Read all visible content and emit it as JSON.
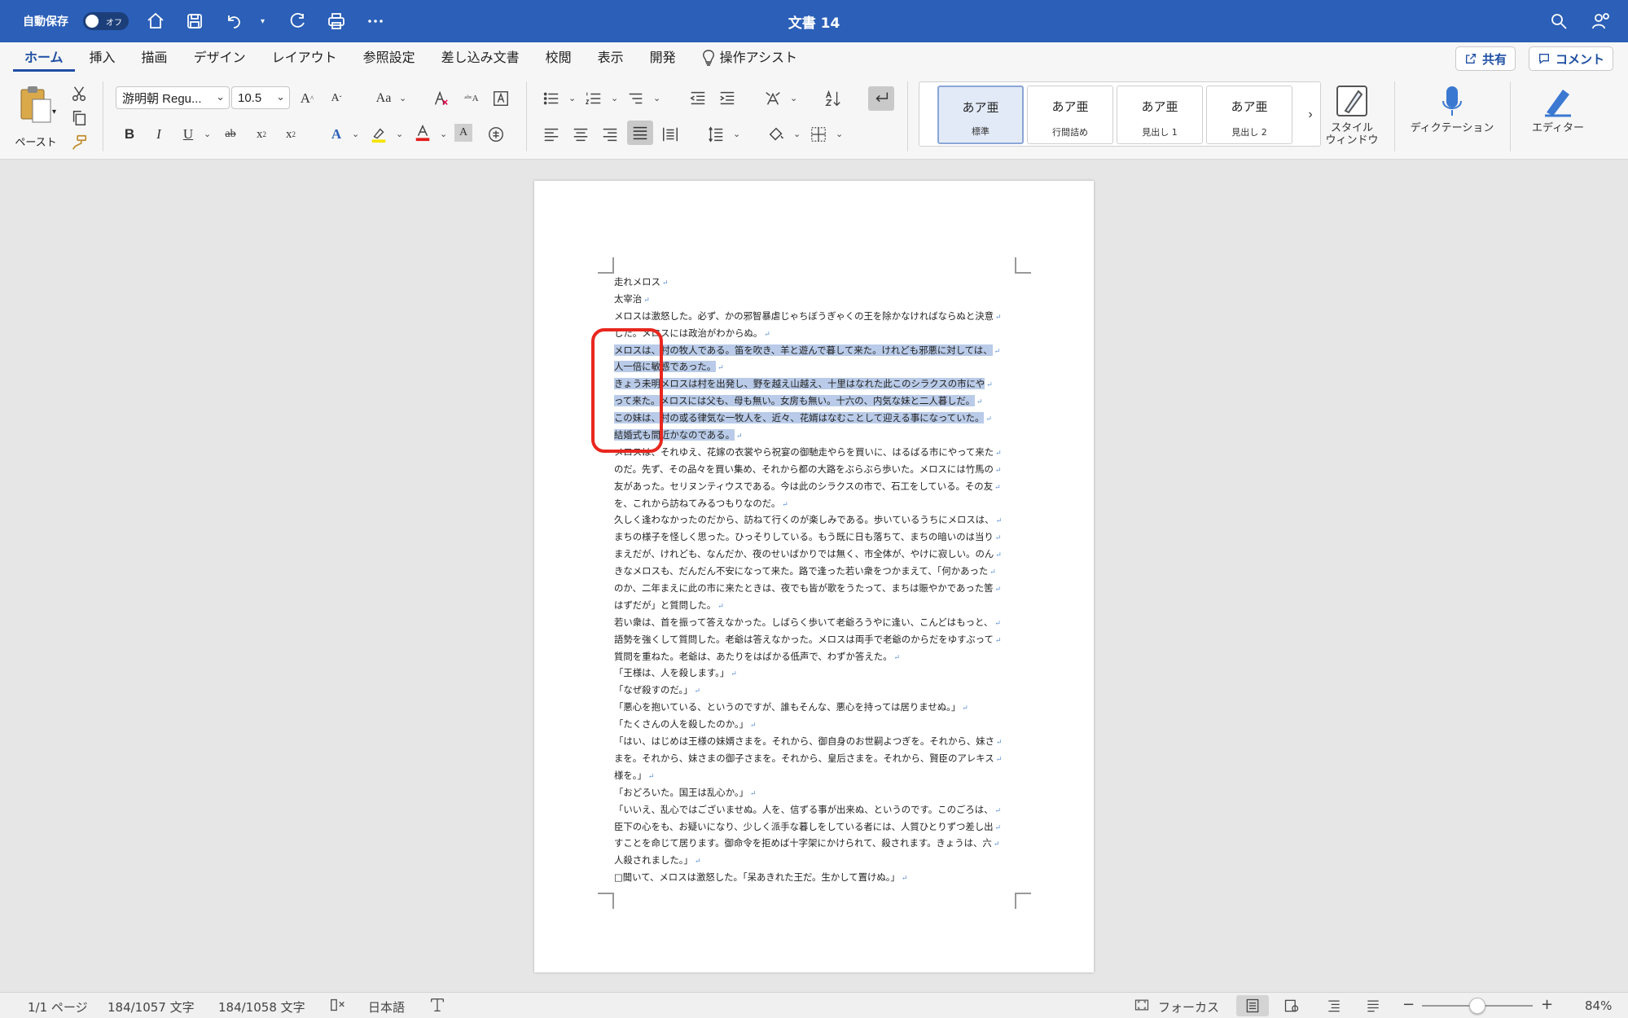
{
  "titlebar": {
    "autosave_label": "自動保存",
    "autosave_state": "オフ",
    "doc_title": "文書 14"
  },
  "menu": {
    "tabs": [
      "ホーム",
      "挿入",
      "描画",
      "デザイン",
      "レイアウト",
      "参照設定",
      "差し込み文書",
      "校閲",
      "表示",
      "開発"
    ],
    "assist": "操作アシスト",
    "share": "共有",
    "comment": "コメント"
  },
  "ribbon": {
    "paste_label": "ペースト",
    "font_name": "游明朝 Regu...",
    "font_size": "10.5",
    "styles": [
      {
        "sample": "あア亜",
        "name": "標準"
      },
      {
        "sample": "あア亜",
        "name": "行間詰め"
      },
      {
        "sample": "あア亜",
        "name": "見出し 1"
      },
      {
        "sample": "あア亜",
        "name": "見出し 2"
      }
    ],
    "style_window_label": "スタイル\nウィンドウ",
    "dictation_label": "ディクテーション",
    "editor_label": "エディター",
    "accent_color": "#2b5fb8",
    "font_color": "#e21b1b",
    "highlight_color": "#f5e400"
  },
  "document": {
    "lines": [
      {
        "text": "走れメロス",
        "hl": false
      },
      {
        "text": "太宰治",
        "hl": false
      },
      {
        "text": "メロスは激怒した。必ず、かの邪智暴虐じゃちぼうぎゃくの王を除かなければならぬと決意",
        "hl": false
      },
      {
        "text": "した。メロスには政治がわからぬ。",
        "hl": false
      },
      {
        "text": " メロスは、村の牧人である。笛を吹き、羊と遊んで暮して来た。けれども邪悪に対しては、",
        "hl": true
      },
      {
        "text": "人一倍に敏感であった。",
        "hl": true
      },
      {
        "text": " きょう未明メロスは村を出発し、野を越え山越え、十里はなれた此このシラクスの市にや",
        "hl": true
      },
      {
        "text": "って来た。メロスには父も、母も無い。女房も無い。十六の、内気な妹と二人暮しだ。",
        "hl": true
      },
      {
        "text": " この妹は、村の或る律気な一牧人を、近々、花婿はなむことして迎える事になっていた。",
        "hl": true
      },
      {
        "text": "結婚式も間近かなのである。",
        "hl": true
      },
      {
        "text": "メロスは、それゆえ、花嫁の衣裳やら祝宴の御馳走やらを買いに、はるばる市にやって来た",
        "hl": false
      },
      {
        "text": "のだ。先ず、その品々を買い集め、それから都の大路をぶらぶら歩いた。メロスには竹馬の",
        "hl": false
      },
      {
        "text": "友があった。セリヌンティウスである。今は此のシラクスの市で、石工をしている。その友",
        "hl": false
      },
      {
        "text": "を、これから訪ねてみるつもりなのだ。",
        "hl": false
      },
      {
        "text": "久しく逢わなかったのだから、訪ねて行くのが楽しみである。歩いているうちにメロスは、",
        "hl": false
      },
      {
        "text": "まちの様子を怪しく思った。ひっそりしている。もう既に日も落ちて、まちの暗いのは当り",
        "hl": false
      },
      {
        "text": "まえだが、けれども、なんだか、夜のせいばかりでは無く、市全体が、やけに寂しい。のん",
        "hl": false
      },
      {
        "text": "きなメロスも、だんだん不安になって来た。路で逢った若い衆をつかまえて、「何かあった",
        "hl": false
      },
      {
        "text": "のか、二年まえに此の市に来たときは、夜でも皆が歌をうたって、まちは賑やかであった筈",
        "hl": false
      },
      {
        "text": "はずだが」と質問した。",
        "hl": false
      },
      {
        "text": "若い衆は、首を振って答えなかった。しばらく歩いて老爺ろうやに逢い、こんどはもっと、",
        "hl": false
      },
      {
        "text": "語勢を強くして質問した。老爺は答えなかった。メロスは両手で老爺のからだをゆすぶって",
        "hl": false
      },
      {
        "text": "質問を重ねた。老爺は、あたりをはばかる低声で、わずか答えた。",
        "hl": false
      },
      {
        "text": "「王様は、人を殺します。」",
        "hl": false
      },
      {
        "text": "「なぜ殺すのだ。」",
        "hl": false
      },
      {
        "text": "「悪心を抱いている、というのですが、誰もそんな、悪心を持っては居りませぬ。」",
        "hl": false
      },
      {
        "text": "「たくさんの人を殺したのか。」",
        "hl": false
      },
      {
        "text": "「はい、はじめは王様の妹婿さまを。それから、御自身のお世嗣よつぎを。それから、妹さ",
        "hl": false
      },
      {
        "text": "まを。それから、妹さまの御子さまを。それから、皇后さまを。それから、賢臣のアレキス",
        "hl": false
      },
      {
        "text": "様を。」",
        "hl": false
      },
      {
        "text": "「おどろいた。国王は乱心か。」",
        "hl": false
      },
      {
        "text": "「いいえ、乱心ではございませぬ。人を、信ずる事が出来ぬ、というのです。このごろは、",
        "hl": false
      },
      {
        "text": "臣下の心をも、お疑いになり、少しく派手な暮しをしている者には、人質ひとりずつ差し出",
        "hl": false
      },
      {
        "text": "すことを命じて居ります。御命令を拒めば十字架にかけられて、殺されます。きょうは、六",
        "hl": false
      },
      {
        "text": "人殺されました。」",
        "hl": false
      },
      {
        "text": "□聞いて、メロスは激怒した。「呆あきれた王だ。生かして置けぬ。」",
        "hl": false
      }
    ]
  },
  "statusbar": {
    "page": "1/1 ページ",
    "chars_selected": "184/1057 文字",
    "chars_total": "184/1058 文字",
    "language": "日本語",
    "focus": "フォーカス",
    "zoom": "84%",
    "zoom_fraction": 0.5
  }
}
